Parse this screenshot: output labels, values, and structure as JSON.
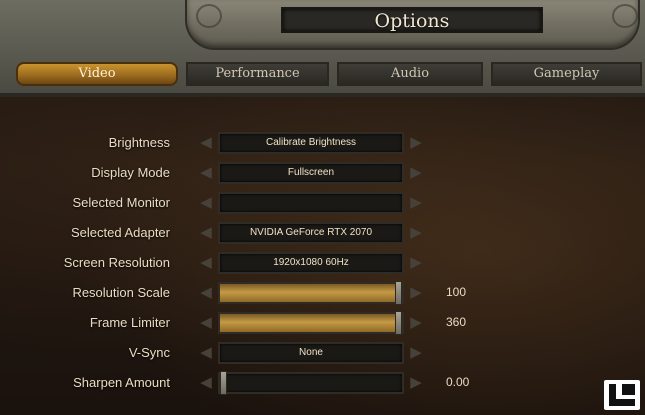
{
  "window": {
    "title": "Options"
  },
  "tabs": [
    {
      "label": "Video",
      "active": true
    },
    {
      "label": "Performance",
      "active": false
    },
    {
      "label": "Audio",
      "active": false
    },
    {
      "label": "Gameplay",
      "active": false
    }
  ],
  "settings": {
    "brightness": {
      "label": "Brightness",
      "value": "Calibrate Brightness"
    },
    "display_mode": {
      "label": "Display Mode",
      "value": "Fullscreen"
    },
    "selected_monitor": {
      "label": "Selected Monitor",
      "value": ""
    },
    "selected_adapter": {
      "label": "Selected Adapter",
      "value": "NVIDIA GeForce RTX 2070"
    },
    "screen_resolution": {
      "label": "Screen Resolution",
      "value": "1920x1080 60Hz"
    },
    "resolution_scale": {
      "label": "Resolution Scale",
      "value": "100",
      "fill_fraction": 1.0
    },
    "frame_limiter": {
      "label": "Frame Limiter",
      "value": "360",
      "fill_fraction": 1.0
    },
    "vsync": {
      "label": "V-Sync",
      "value": "None"
    },
    "sharpen_amount": {
      "label": "Sharpen Amount",
      "value": "0.00",
      "fill_fraction": 0.0
    }
  },
  "colors": {
    "accent": "#c9942e",
    "text": "#e9dcc2"
  }
}
